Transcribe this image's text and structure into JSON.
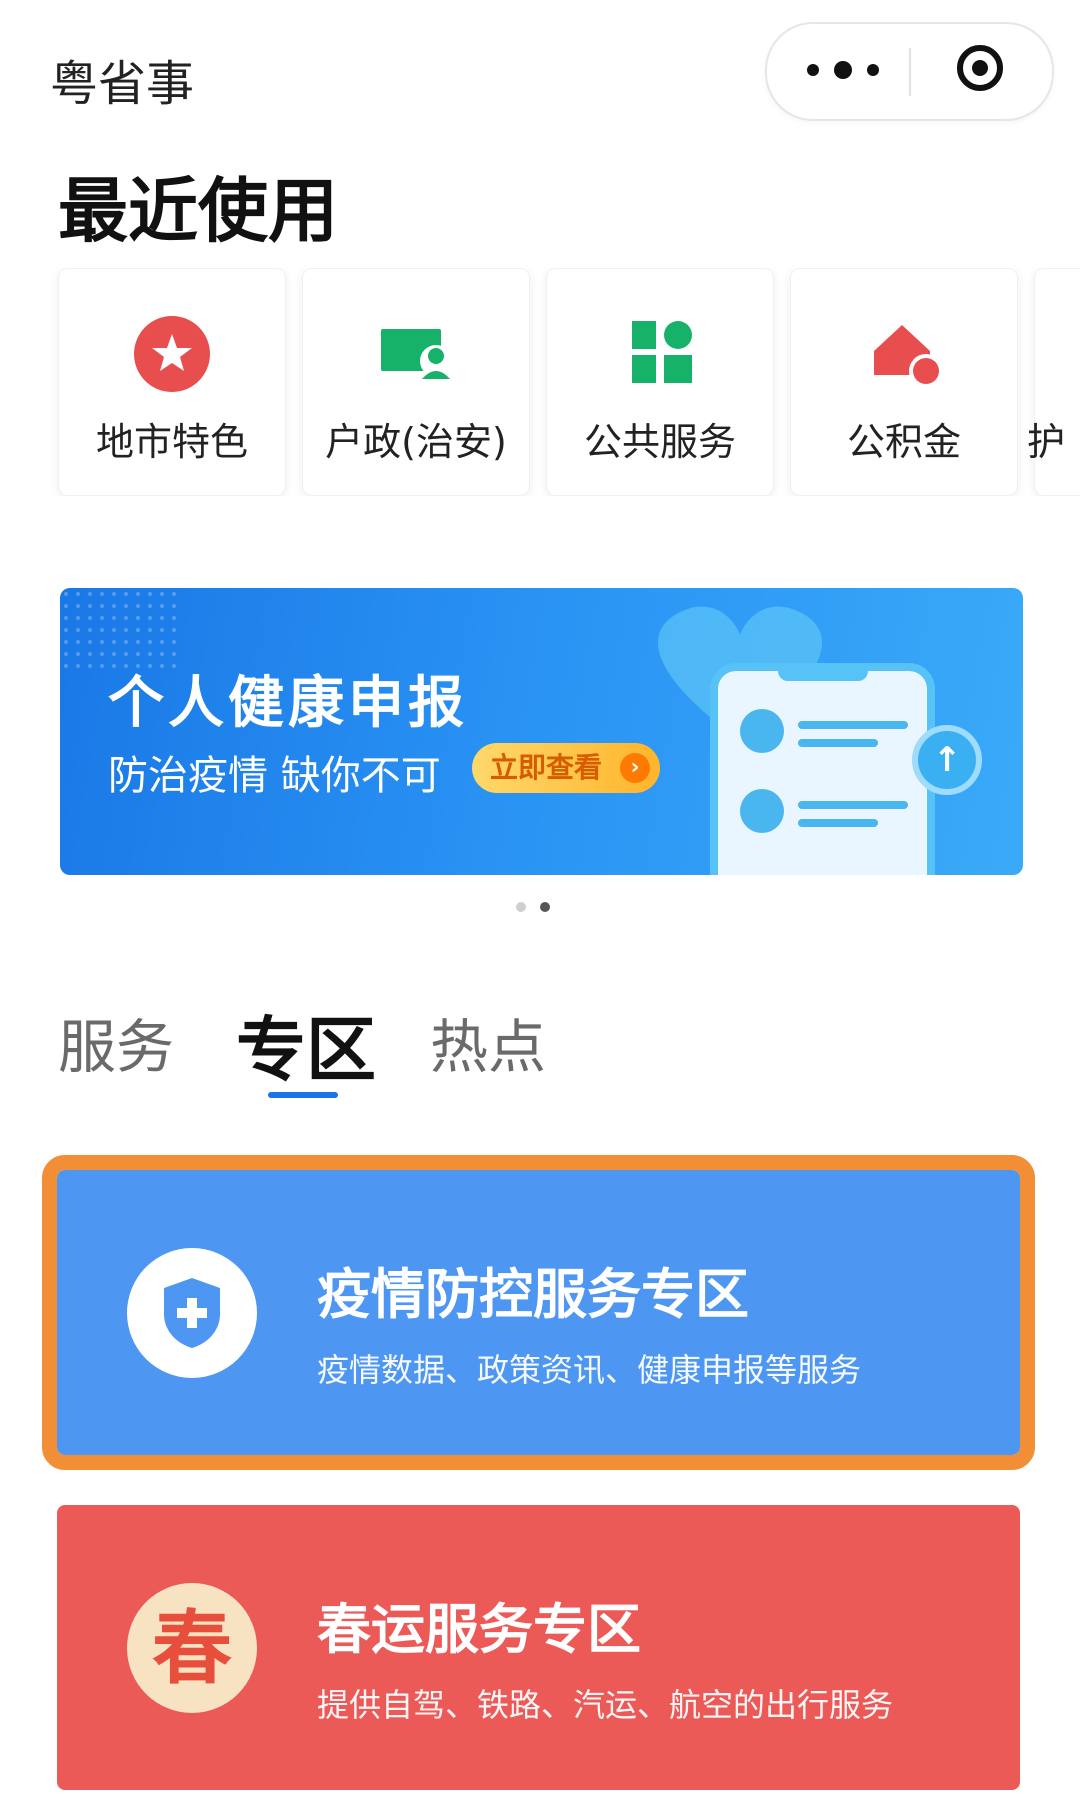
{
  "app": {
    "title": "粤省事"
  },
  "capsule": {
    "more_icon": "more-dots-icon",
    "close_icon": "close-target-icon"
  },
  "recent": {
    "title": "最近使用",
    "items": [
      {
        "label": "地市特色",
        "icon": "star-badge-icon",
        "color": "#e84e4e"
      },
      {
        "label": "户政(治安)",
        "icon": "id-card-person-icon",
        "color": "#17b26a"
      },
      {
        "label": "公共服务",
        "icon": "grid-apps-icon",
        "color": "#17b26a"
      },
      {
        "label": "公积金",
        "icon": "house-coin-icon",
        "color": "#e84e4e"
      },
      {
        "label": "护",
        "icon": "partial-icon",
        "color": "#1a73e8"
      }
    ]
  },
  "banner": {
    "title": "个人健康申报",
    "subtitle": "防治疫情 缺你不可",
    "button": "立即查看",
    "button_arrow": "›",
    "upload_glyph": "↑"
  },
  "pager": {
    "count": 2,
    "active_index": 1
  },
  "tabs": [
    {
      "label": "服务",
      "active": false
    },
    {
      "label": "专区",
      "active": true
    },
    {
      "label": "热点",
      "active": false
    }
  ],
  "zones": [
    {
      "title": "疫情防控服务专区",
      "subtitle": "疫情数据、政策资讯、健康申报等服务",
      "color": "#4d97f2",
      "icon": "shield-plus-icon",
      "highlighted": true
    },
    {
      "title": "春运服务专区",
      "subtitle": "提供自驾、铁路、汽运、航空的出行服务",
      "color": "#ec5a57",
      "icon": "chun-character-icon",
      "icon_text": "春",
      "highlighted": false
    }
  ],
  "colors": {
    "accent": "#1a73e8",
    "highlight_border": "#f28f36"
  }
}
